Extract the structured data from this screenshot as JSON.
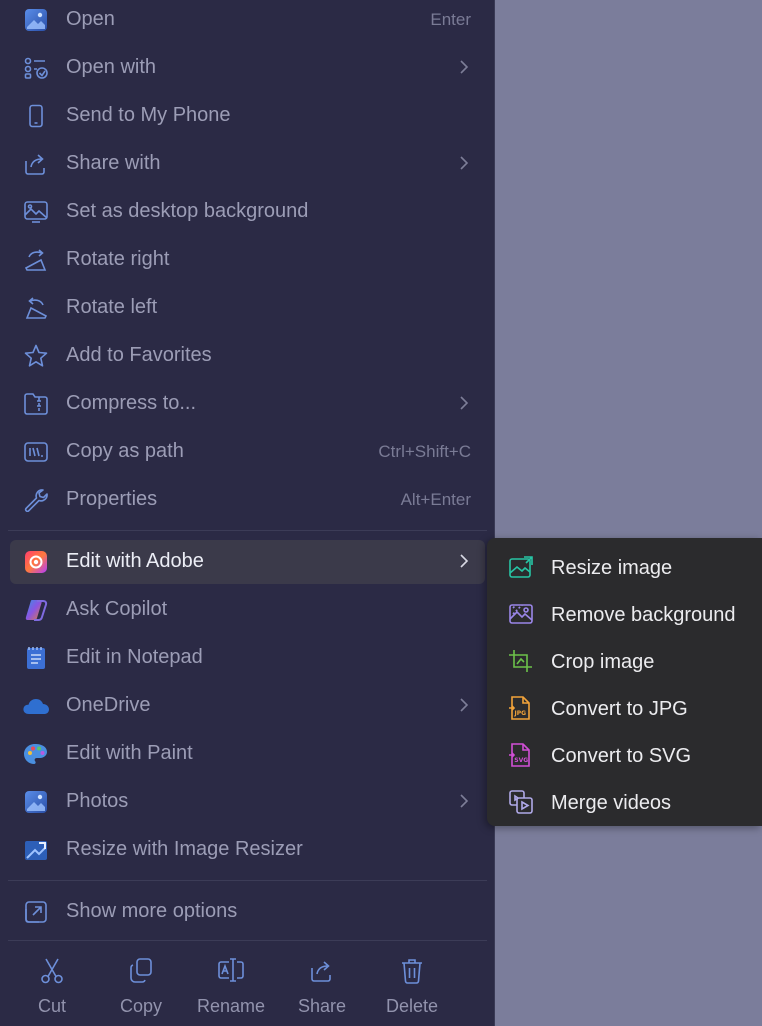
{
  "menu": {
    "items": [
      {
        "label": "Open",
        "shortcut": "Enter",
        "icon": "photos-icon"
      },
      {
        "label": "Open with",
        "icon": "open-with-icon",
        "submenu": true
      },
      {
        "label": "Send to My Phone",
        "icon": "phone-icon"
      },
      {
        "label": "Share with",
        "icon": "share-icon",
        "submenu": true
      },
      {
        "label": "Set as desktop background",
        "icon": "desktop-background-icon"
      },
      {
        "label": "Rotate right",
        "icon": "rotate-right-icon"
      },
      {
        "label": "Rotate left",
        "icon": "rotate-left-icon"
      },
      {
        "label": "Add to Favorites",
        "icon": "star-icon"
      },
      {
        "label": "Compress to...",
        "icon": "zip-folder-icon",
        "submenu": true
      },
      {
        "label": "Copy as path",
        "shortcut": "Ctrl+Shift+C",
        "icon": "copy-path-icon"
      },
      {
        "label": "Properties",
        "shortcut": "Alt+Enter",
        "icon": "wrench-icon"
      },
      {
        "label": "Edit with Adobe",
        "icon": "adobe-cc-icon",
        "submenu": true,
        "active": true
      },
      {
        "label": "Ask Copilot",
        "icon": "copilot-icon"
      },
      {
        "label": "Edit in Notepad",
        "icon": "notepad-icon"
      },
      {
        "label": "OneDrive",
        "icon": "onedrive-icon",
        "submenu": true
      },
      {
        "label": "Edit with Paint",
        "icon": "paint-icon"
      },
      {
        "label": "Photos",
        "icon": "photos-icon",
        "submenu": true
      },
      {
        "label": "Resize with Image Resizer",
        "icon": "image-resizer-icon"
      },
      {
        "label": "Show more options",
        "icon": "show-more-icon"
      }
    ]
  },
  "toolbar": {
    "buttons": [
      {
        "label": "Cut",
        "icon": "scissors-icon"
      },
      {
        "label": "Copy",
        "icon": "copy-icon"
      },
      {
        "label": "Rename",
        "icon": "rename-icon"
      },
      {
        "label": "Share",
        "icon": "share-icon"
      },
      {
        "label": "Delete",
        "icon": "trash-icon"
      }
    ]
  },
  "submenu": {
    "items": [
      {
        "label": "Resize image",
        "icon": "resize-image-icon",
        "color": "#27c4a4"
      },
      {
        "label": "Remove background",
        "icon": "remove-background-icon",
        "color": "#9a86e8"
      },
      {
        "label": "Crop image",
        "icon": "crop-icon",
        "color": "#6cc24a"
      },
      {
        "label": "Convert to JPG",
        "icon": "jpg-file-icon",
        "color": "#f2a33a"
      },
      {
        "label": "Convert to SVG",
        "icon": "svg-file-icon",
        "color": "#d14fd6"
      },
      {
        "label": "Merge videos",
        "icon": "merge-videos-icon",
        "color": "#b0a9e8"
      }
    ]
  }
}
